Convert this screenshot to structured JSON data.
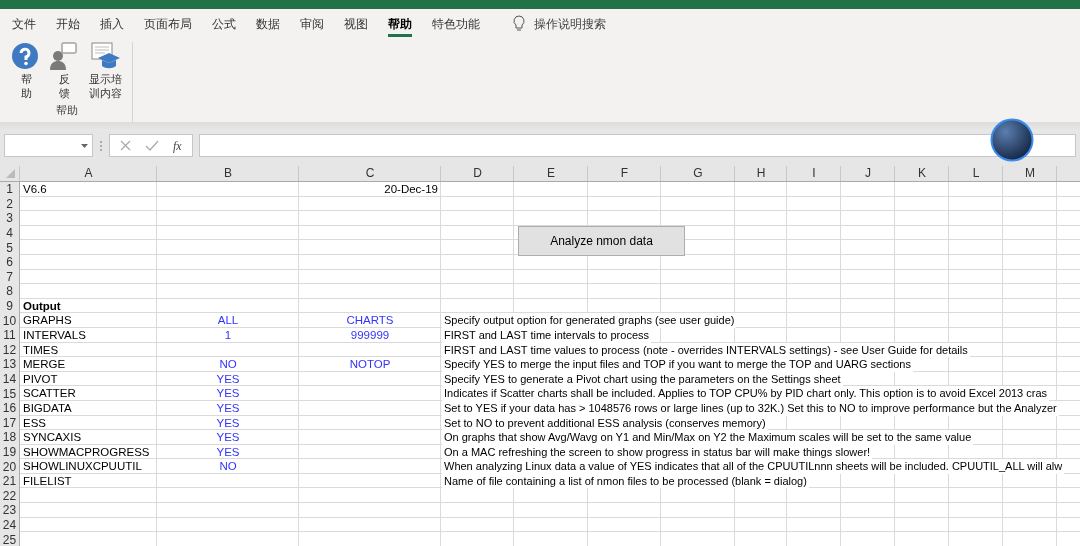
{
  "ribbon": {
    "tabs": [
      {
        "label": "文件",
        "selected": false
      },
      {
        "label": "开始",
        "selected": false
      },
      {
        "label": "插入",
        "selected": false
      },
      {
        "label": "页面布局",
        "selected": false
      },
      {
        "label": "公式",
        "selected": false
      },
      {
        "label": "数据",
        "selected": false
      },
      {
        "label": "审阅",
        "selected": false
      },
      {
        "label": "视图",
        "selected": false
      },
      {
        "label": "帮助",
        "selected": true
      },
      {
        "label": "特色功能",
        "selected": false
      }
    ],
    "tell_me": "操作说明搜索",
    "groups": [
      {
        "label": "帮助",
        "buttons": [
          {
            "kind": "help",
            "label": "帮助"
          },
          {
            "kind": "feedback",
            "label": "反馈"
          },
          {
            "kind": "training",
            "label": "显示培训内容"
          }
        ]
      }
    ]
  },
  "formula_bar": {
    "fx": "fx"
  },
  "sheet": {
    "columns": [
      "A",
      "B",
      "C",
      "D",
      "E",
      "F",
      "G",
      "H",
      "I",
      "J",
      "K",
      "L",
      "M"
    ],
    "rows": [
      {
        "number": "1",
        "kind": "entry",
        "a": "V6.6",
        "c": "20-Dec-19"
      },
      {
        "number": "2",
        "kind": "entry"
      },
      {
        "number": "3",
        "kind": "entry"
      },
      {
        "number": "4",
        "kind": "entry"
      },
      {
        "number": "5",
        "kind": "entry"
      },
      {
        "number": "6",
        "kind": "entry"
      },
      {
        "number": "7",
        "kind": "entry"
      },
      {
        "number": "8",
        "kind": "entry"
      },
      {
        "number": "9",
        "kind": "heading",
        "a": "Output"
      },
      {
        "number": "10",
        "kind": "entry",
        "a": "GRAPHS",
        "b": "ALL",
        "c": "CHARTS",
        "d": "Specify output option for generated graphs (see user guide)"
      },
      {
        "number": "11",
        "kind": "entry",
        "a": "INTERVALS",
        "b": "1",
        "c": "999999",
        "d": "FIRST and LAST time intervals to process"
      },
      {
        "number": "12",
        "kind": "entry",
        "a": "TIMES",
        "d": "FIRST and LAST time values to process (note - overrides INTERVALS settings) - see User Guide for details"
      },
      {
        "number": "13",
        "kind": "entry",
        "a": "MERGE",
        "b": "NO",
        "c": "NOTOP",
        "d": "Specify YES to merge the input files and TOP if you want to merge the TOP and UARG sections"
      },
      {
        "number": "14",
        "kind": "entry",
        "a": "PIVOT",
        "b": "YES",
        "d": "Specify YES to generate a Pivot chart using the parameters on the Settings sheet"
      },
      {
        "number": "15",
        "kind": "entry",
        "a": "SCATTER",
        "b": "YES",
        "d": "Indicates if Scatter charts shall be included.  Applies to TOP CPU% by PID chart only.  This option is to avoid Excel 2013 cras"
      },
      {
        "number": "16",
        "kind": "entry",
        "a": "BIGDATA",
        "b": "YES",
        "d": "Set to YES if your data has > 1048576 rows or large lines (up to 32K.)  Set this to NO to improve performance but the Analyzer"
      },
      {
        "number": "17",
        "kind": "entry",
        "a": "ESS",
        "b": "YES",
        "d": "Set to NO to prevent additional ESS analysis (conserves memory)"
      },
      {
        "number": "18",
        "kind": "entry",
        "a": "SYNCAXIS",
        "b": "YES",
        "d": "On graphs that show Avg/Wavg on Y1 and Min/Max on Y2 the Maximum scales will be set to the same value"
      },
      {
        "number": "19",
        "kind": "entry",
        "a": "SHOWMACPROGRESS",
        "b": "YES",
        "d": "On a MAC refreshing the screen to show progress in status bar will make things slower!"
      },
      {
        "number": "20",
        "kind": "entry",
        "a": "SHOWLINUXCPUUTIL",
        "b": "NO",
        "d": "When analyzing Linux data a value of YES indicates that all of the CPUUTILnnn sheets will be included.  CPUUTIL_ALL will alw"
      },
      {
        "number": "21",
        "kind": "entry",
        "a": "FILELIST",
        "d": "Name of file containing a list of nmon files to be processed (blank = dialog)"
      },
      {
        "number": "22",
        "kind": "entry"
      },
      {
        "number": "23",
        "kind": "entry"
      },
      {
        "number": "24",
        "kind": "entry"
      },
      {
        "number": "25",
        "kind": "entry"
      }
    ],
    "button": {
      "label": "Analyze nmon data"
    }
  }
}
